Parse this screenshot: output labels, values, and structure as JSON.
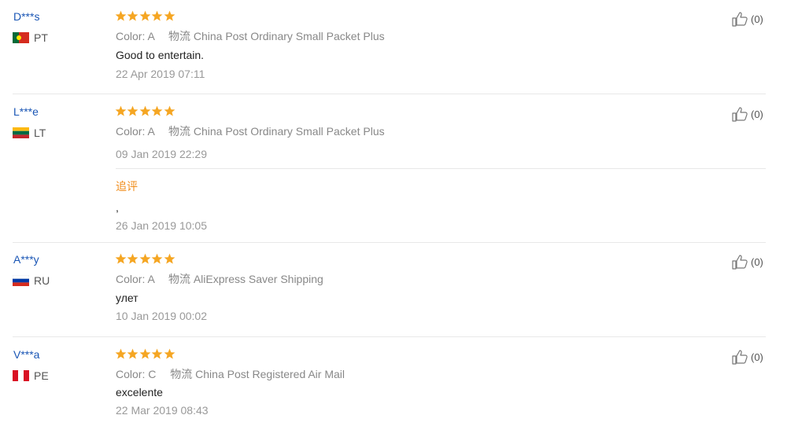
{
  "reviews": [
    {
      "user": "D***s",
      "country": "PT",
      "stars": 5,
      "color_label": "Color:",
      "color_value": "A",
      "shipping_label": "物流",
      "shipping_value": "China Post Ordinary Small Packet Plus",
      "text": "Good to entertain.",
      "date": "22 Apr 2019 07:11",
      "helpful": "(0)"
    },
    {
      "user": "L***e",
      "country": "LT",
      "stars": 5,
      "color_label": "Color:",
      "color_value": "A",
      "shipping_label": "物流",
      "shipping_value": "China Post Ordinary Small Packet Plus",
      "date": "09 Jan 2019 22:29",
      "followup_label": "追评",
      "followup_text": ",",
      "followup_date": "26 Jan 2019 10:05",
      "helpful": "(0)"
    },
    {
      "user": "A***y",
      "country": "RU",
      "stars": 5,
      "color_label": "Color:",
      "color_value": "A",
      "shipping_label": "物流",
      "shipping_value": "AliExpress Saver Shipping",
      "text": "улет",
      "date": "10 Jan 2019 00:02",
      "helpful": "(0)"
    },
    {
      "user": "V***a",
      "country": "PE",
      "stars": 5,
      "color_label": "Color:",
      "color_value": "C",
      "shipping_label": "物流",
      "shipping_value": "China Post Registered Air Mail",
      "text": "excelente",
      "date": "22 Mar 2019 08:43",
      "helpful": "(0)"
    }
  ],
  "colors": {
    "star": "#f5a623",
    "username": "#1a56b5",
    "followup": "#f08c1a"
  },
  "icons": {
    "star": "star-icon",
    "helpful": "thumbs-up-icon"
  }
}
